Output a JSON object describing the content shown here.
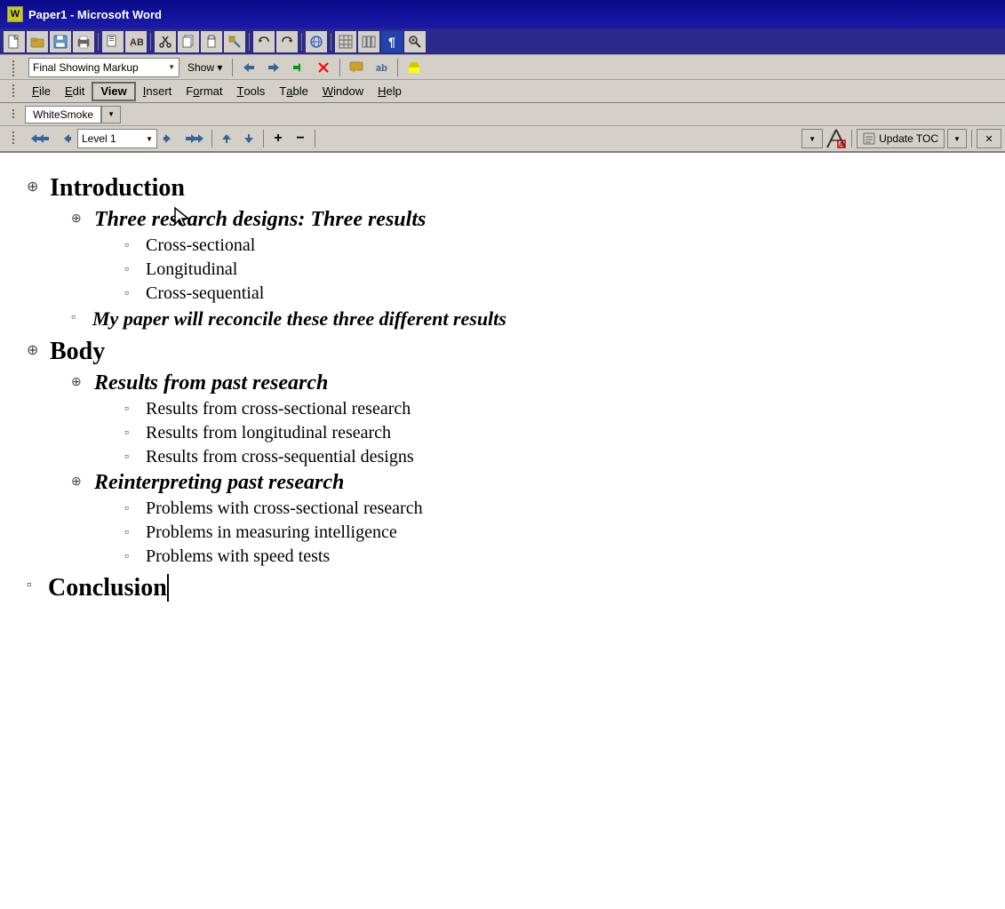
{
  "titleBar": {
    "icon": "W",
    "title": "Paper1 - Microsoft Word"
  },
  "markupBar": {
    "dropdown": "Final Showing Markup",
    "showBtn": "Show ▾"
  },
  "menuBar": {
    "items": [
      {
        "label": "File",
        "underline": "F"
      },
      {
        "label": "Edit",
        "underline": "E"
      },
      {
        "label": "View",
        "underline": "V",
        "active": true
      },
      {
        "label": "Insert",
        "underline": "I"
      },
      {
        "label": "Format",
        "underline": "o"
      },
      {
        "label": "Tools",
        "underline": "T"
      },
      {
        "label": "Table",
        "underline": "a"
      },
      {
        "label": "Window",
        "underline": "W"
      },
      {
        "label": "Help",
        "underline": "H"
      }
    ]
  },
  "whitesmokeBar": {
    "label": "WhiteSmoke"
  },
  "outlineBar": {
    "navBack": "◄◄",
    "navPrev": "◄",
    "levelDropdown": "Level 1",
    "navNext": "►",
    "navFwd": "►►",
    "up": "▲",
    "down": "▼",
    "expand": "+",
    "collapse": "−",
    "updateTOC": "Update TOC"
  },
  "document": {
    "items": [
      {
        "level": 1,
        "handle": "⊕",
        "text": "Introduction"
      },
      {
        "level": 2,
        "handle": "⊕",
        "text": "Three research designs: Three results"
      },
      {
        "level": 3,
        "bullet": "▫",
        "text": "Cross-sectional"
      },
      {
        "level": 3,
        "bullet": "▫",
        "text": "Longitudinal"
      },
      {
        "level": 3,
        "bullet": "▫",
        "text": "Cross-sequential"
      },
      {
        "level": "2sub",
        "bullet": "▫",
        "text": "My paper will reconcile these three different results"
      },
      {
        "level": 1,
        "handle": "⊕",
        "text": "Body"
      },
      {
        "level": 2,
        "handle": "⊕",
        "text": "Results from past research"
      },
      {
        "level": 3,
        "bullet": "▫",
        "text": "Results from cross-sectional research"
      },
      {
        "level": 3,
        "bullet": "▫",
        "text": "Results from longitudinal research"
      },
      {
        "level": 3,
        "bullet": "▫",
        "text": "Results from cross-sequential designs"
      },
      {
        "level": 2,
        "handle": "⊕",
        "text": "Reinterpreting past research"
      },
      {
        "level": 3,
        "bullet": "▫",
        "text": "Problems with cross-sectional research"
      },
      {
        "level": 3,
        "bullet": "▫",
        "text": "Problems in measuring intelligence"
      },
      {
        "level": 3,
        "bullet": "▫",
        "text": "Problems with speed tests"
      },
      {
        "level": "1sub",
        "bullet": "▫",
        "text": "Conclusion"
      }
    ]
  }
}
